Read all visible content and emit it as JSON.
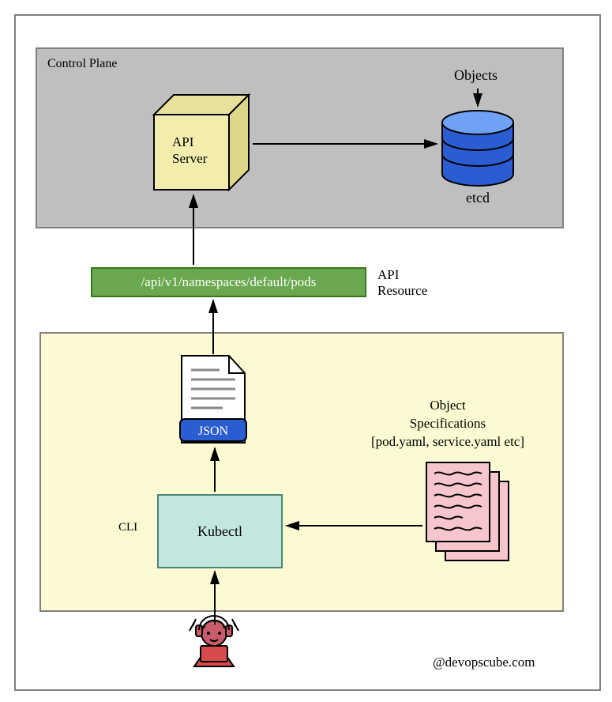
{
  "control_plane": {
    "label": "Control Plane"
  },
  "api_server": {
    "line1": "API",
    "line2": "Server"
  },
  "etcd": {
    "label": "etcd",
    "top_label": "Objects"
  },
  "api_path": {
    "path": "/api/v1/namespaces/default/pods",
    "label_line1": "API",
    "label_line2": "Resource"
  },
  "json_doc": {
    "label": "JSON"
  },
  "kubectl": {
    "label": "Kubectl",
    "cli": "CLI"
  },
  "object_specs": {
    "line1": "Object",
    "line2": "Specifications",
    "line3": "[pod.yaml, service.yaml etc]"
  },
  "attribution": "@devopscube.com"
}
